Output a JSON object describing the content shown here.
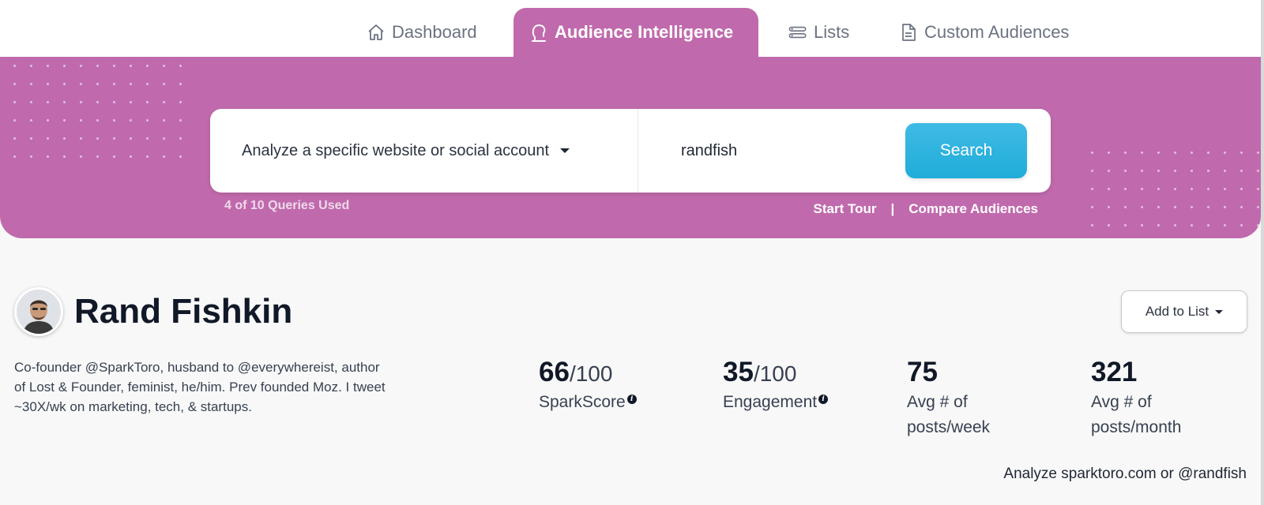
{
  "nav": {
    "tabs": [
      {
        "label": "Dashboard",
        "icon": "home-icon"
      },
      {
        "label": "Audience Intelligence",
        "icon": "head-profile-icon",
        "active": true
      },
      {
        "label": "Lists",
        "icon": "list-icon"
      },
      {
        "label": "Custom Audiences",
        "icon": "document-icon"
      }
    ]
  },
  "hero": {
    "mode_label": "Analyze a specific website or social account",
    "query_value": "randfish",
    "search_label": "Search",
    "queries_used": "4 of 10 Queries Used",
    "start_tour": "Start Tour",
    "separator": "|",
    "compare": "Compare Audiences"
  },
  "profile": {
    "name": "Rand Fishkin",
    "add_to_list": "Add to List",
    "bio": "Co-founder @SparkToro, husband to @everywhereist, author of Lost & Founder, feminist, he/him. Prev founded Moz. I tweet ~30X/wk on marketing, tech, & startups.",
    "stats": [
      {
        "value": "66",
        "denominator": "/100",
        "label": "SparkScore",
        "info": "i"
      },
      {
        "value": "35",
        "denominator": "/100",
        "label": "Engagement",
        "info": "i"
      },
      {
        "value": "75",
        "label": "Avg # of posts/week"
      },
      {
        "value": "321",
        "label": "Avg # of posts/month"
      }
    ],
    "analyze_link": "Analyze sparktoro.com or @randfish"
  },
  "colors": {
    "brand": "#c06aad",
    "search_button": "#29b1dd"
  }
}
